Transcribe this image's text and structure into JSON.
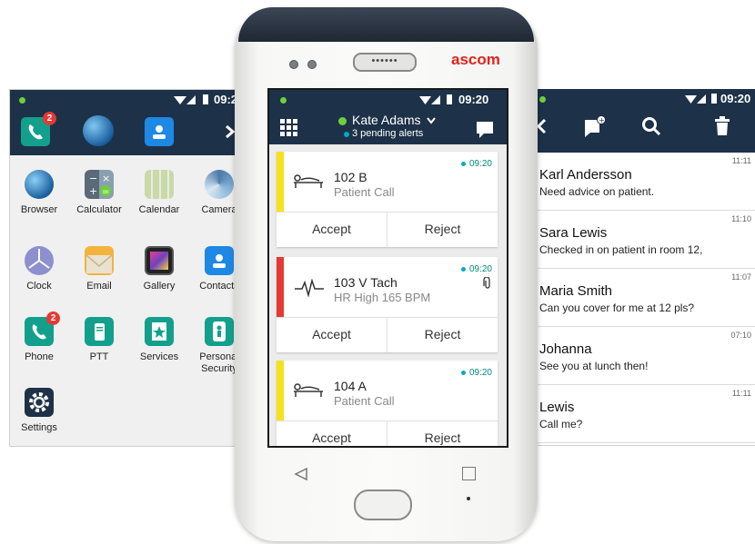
{
  "left_screen": {
    "status_time": "09:2",
    "dock_badge": "2",
    "apps": [
      {
        "label": "Browser"
      },
      {
        "label": "Calculator"
      },
      {
        "label": "Calendar"
      },
      {
        "label": "Camera"
      },
      {
        "label": "Clock"
      },
      {
        "label": "Email"
      },
      {
        "label": "Gallery"
      },
      {
        "label": "Contacts"
      },
      {
        "label": "Phone",
        "badge": "2"
      },
      {
        "label": "PTT"
      },
      {
        "label": "Services"
      },
      {
        "label": "Personal",
        "label2": "Security"
      },
      {
        "label": "Settings"
      }
    ]
  },
  "phone": {
    "brand": "ascom",
    "status_time": "09:20",
    "user_name": "Kate Adams",
    "pending_alerts": "3 pending alerts",
    "alerts": [
      {
        "title": "102 B",
        "subtitle": "Patient Call",
        "time": "09:20",
        "accept": "Accept",
        "reject": "Reject",
        "color": "#f7e11b"
      },
      {
        "title": "103 V Tach",
        "subtitle": "HR High 165 BPM",
        "time": "09:20",
        "accept": "Accept",
        "reject": "Reject",
        "color": "#e53935"
      },
      {
        "title": "104 A",
        "subtitle": "Patient Call",
        "time": "09:20",
        "accept": "Accept",
        "reject": "Reject",
        "color": "#f7e11b"
      }
    ]
  },
  "right_screen": {
    "status_time": "09:20",
    "messages": [
      {
        "name": "Karl Andersson",
        "text": "Need advice on patient.",
        "time": "11:11"
      },
      {
        "name": "Sara Lewis",
        "text": "Checked in on patient in room 12,",
        "time": "11:10"
      },
      {
        "name": "Maria Smith",
        "text": "Can you cover for me at 12 pls?",
        "time": "11:07"
      },
      {
        "name": "Johanna",
        "text": "See you at lunch then!",
        "time": "07:10"
      },
      {
        "name": "Lewis",
        "text": "Call me?",
        "time": "11:11"
      }
    ]
  },
  "colors": {
    "header_navy": "#1d3148",
    "accent_green": "#6fcf3b",
    "alert_yellow": "#f7e11b",
    "alert_red": "#e53935",
    "brand_red": "#e2231a"
  }
}
